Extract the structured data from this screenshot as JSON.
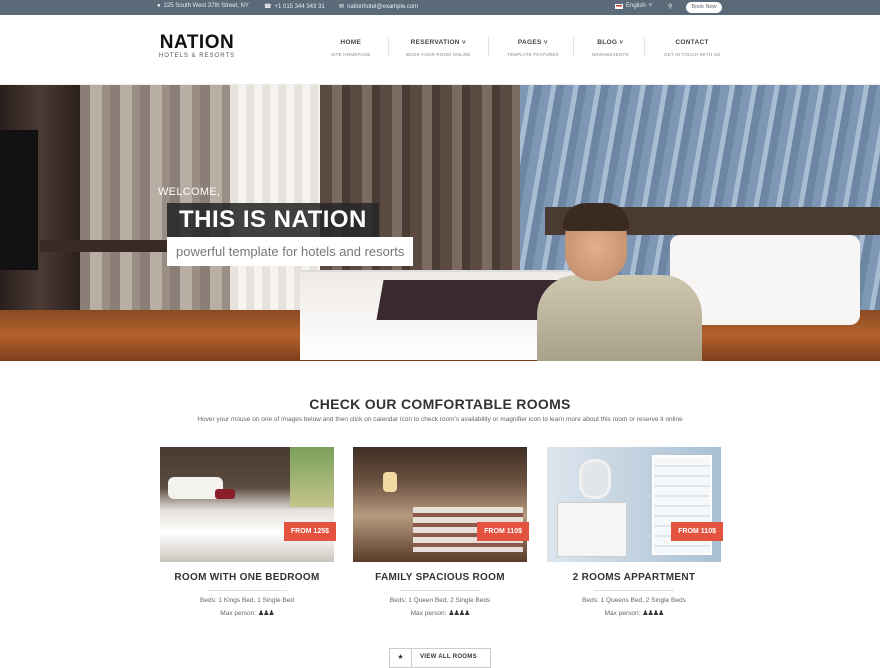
{
  "topbar": {
    "address": "225 South West 37th Street, NY",
    "phone": "+1 015 344 343 31",
    "email": "nationhotel@example.com",
    "language": "English",
    "book_now": "Book Now"
  },
  "logo": {
    "name": "NATION",
    "tagline": "HOTELS & RESORTS"
  },
  "nav": {
    "items": [
      {
        "label": "HOME",
        "sub": "SITE HOMEPAGE",
        "has_dropdown": false
      },
      {
        "label": "RESERVATION",
        "sub": "BOOK YOUR ROOM ONLINE",
        "has_dropdown": true
      },
      {
        "label": "PAGES",
        "sub": "TEMPLATE FEATURES",
        "has_dropdown": true
      },
      {
        "label": "BLOG",
        "sub": "NEWS&EVENTS",
        "has_dropdown": true
      },
      {
        "label": "CONTACT",
        "sub": "GET IN TOUCH WITH US",
        "has_dropdown": false
      }
    ]
  },
  "hero": {
    "welcome": "WELCOME,",
    "title": "THIS IS NATION",
    "subtitle": "powerful template for hotels and resorts"
  },
  "rooms_section": {
    "title": "CHECK OUR COMFORTABLE ROOMS",
    "subtitle": "Hover your mouse on one of images below and then click on calendar icon to check room's availability or magnifier icon to learn more about this room or reserve it online",
    "rooms": [
      {
        "name": "ROOM WITH ONE BEDROOM",
        "price": "FROM 125$",
        "beds": "Beds: 1 Kings Bed, 1 Single Bed",
        "max_label": "Max person:",
        "persons": "3"
      },
      {
        "name": "FAMILY SPACIOUS ROOM",
        "price": "FROM 110$",
        "beds": "Beds: 1 Queen Bed, 2 Single Beds",
        "max_label": "Max person:",
        "persons": "4"
      },
      {
        "name": "2 ROOMS APPARTMENT",
        "price": "FROM 110$",
        "beds": "Beds: 1 Queens Bed, 2 Single Beds",
        "max_label": "Max person:",
        "persons": "4"
      }
    ],
    "view_all": "VIEW ALL ROOMS"
  },
  "colors": {
    "topbar": "#5b6a78",
    "price_badge": "#e4533f"
  }
}
